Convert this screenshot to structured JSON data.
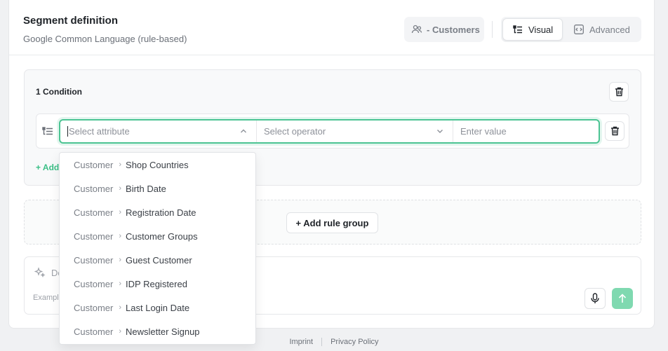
{
  "header": {
    "title": "Segment definition",
    "subtitle": "Google Common Language (rule-based)",
    "audience_label": "- Customers",
    "mode_visual": "Visual",
    "mode_advanced": "Advanced"
  },
  "rule_group": {
    "condition_count_label": "1 Condition",
    "condition": {
      "attribute_placeholder": "Select attribute",
      "operator_placeholder": "Select operator",
      "value_placeholder": "Enter value"
    },
    "add_condition_label": "+ Add"
  },
  "add_rule_group_label": "+ Add rule group",
  "ai_prompt": {
    "placeholder": "De",
    "example_prefix": "Example"
  },
  "attribute_dropdown": {
    "items": [
      {
        "category": "Customer",
        "attribute": "Shop Countries"
      },
      {
        "category": "Customer",
        "attribute": "Birth Date"
      },
      {
        "category": "Customer",
        "attribute": "Registration Date"
      },
      {
        "category": "Customer",
        "attribute": "Customer Groups"
      },
      {
        "category": "Customer",
        "attribute": "Guest Customer"
      },
      {
        "category": "Customer",
        "attribute": "IDP Registered"
      },
      {
        "category": "Customer",
        "attribute": "Last Login Date"
      },
      {
        "category": "Customer",
        "attribute": "Newsletter Signup"
      }
    ]
  },
  "footer": {
    "imprint": "Imprint",
    "privacy": "Privacy Policy"
  },
  "colors": {
    "accent": "#3bbf86",
    "focus_ring": "#4cc493",
    "send_button": "#7fd9b0"
  }
}
